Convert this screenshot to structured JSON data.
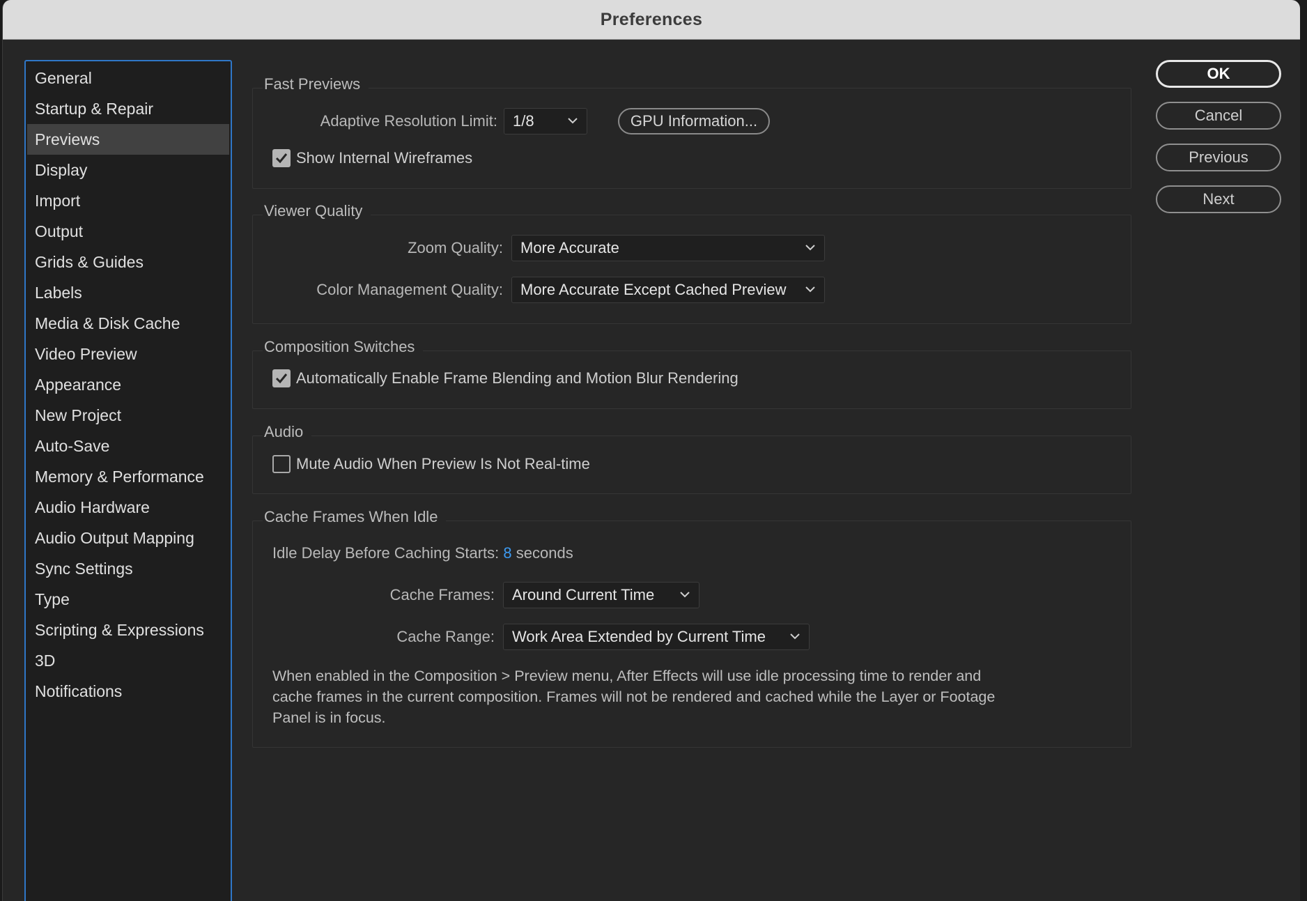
{
  "window": {
    "title": "Preferences"
  },
  "sidebar": {
    "items": [
      {
        "label": "General"
      },
      {
        "label": "Startup & Repair"
      },
      {
        "label": "Previews",
        "selected": true
      },
      {
        "label": "Display"
      },
      {
        "label": "Import"
      },
      {
        "label": "Output"
      },
      {
        "label": "Grids & Guides"
      },
      {
        "label": "Labels"
      },
      {
        "label": "Media & Disk Cache"
      },
      {
        "label": "Video Preview"
      },
      {
        "label": "Appearance"
      },
      {
        "label": "New Project"
      },
      {
        "label": "Auto-Save"
      },
      {
        "label": "Memory & Performance"
      },
      {
        "label": "Audio Hardware"
      },
      {
        "label": "Audio Output Mapping"
      },
      {
        "label": "Sync Settings"
      },
      {
        "label": "Type"
      },
      {
        "label": "Scripting & Expressions"
      },
      {
        "label": "3D"
      },
      {
        "label": "Notifications"
      }
    ]
  },
  "fast_previews": {
    "title": "Fast Previews",
    "adaptive_label": "Adaptive Resolution Limit:",
    "adaptive_value": "1/8",
    "gpu_button": "GPU Information...",
    "wireframes_label": "Show Internal Wireframes",
    "wireframes_checked": true
  },
  "viewer_quality": {
    "title": "Viewer Quality",
    "zoom_label": "Zoom Quality:",
    "zoom_value": "More Accurate",
    "color_label": "Color Management Quality:",
    "color_value": "More Accurate Except Cached Preview"
  },
  "composition_switches": {
    "title": "Composition Switches",
    "blend_label": "Automatically Enable Frame Blending and Motion Blur Rendering",
    "blend_checked": true
  },
  "audio": {
    "title": "Audio",
    "mute_label": "Mute Audio When Preview Is Not Real-time",
    "mute_checked": false
  },
  "cache_idle": {
    "title": "Cache Frames When Idle",
    "delay_label": "Idle Delay Before Caching Starts:",
    "delay_value": "8",
    "delay_unit": "seconds",
    "frames_label": "Cache Frames:",
    "frames_value": "Around Current Time",
    "range_label": "Cache Range:",
    "range_value": "Work Area Extended by Current Time",
    "note_line1": "When enabled in the Composition > Preview menu, After Effects will use idle processing time to render and",
    "note_line2": "cache frames in the current composition. Frames will not be rendered and cached while the Layer or Footage",
    "note_line3": "Panel is in focus."
  },
  "buttons": {
    "ok": "OK",
    "cancel": "Cancel",
    "previous": "Previous",
    "next": "Next"
  },
  "colors": {
    "accent": "#2f77c7",
    "link_value": "#3d9bf2",
    "background": "#262626"
  }
}
